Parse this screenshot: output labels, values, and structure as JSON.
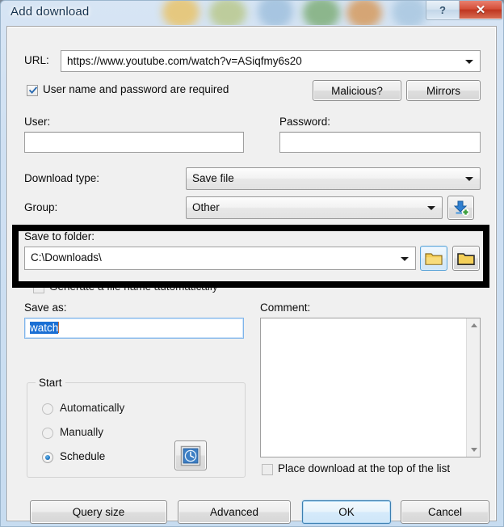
{
  "window": {
    "title": "Add download",
    "help_button": "?",
    "close_button": "✕"
  },
  "form": {
    "url_label": "URL:",
    "url_value": "https://www.youtube.com/watch?v=ASiqfmy6s20",
    "credentials_checkbox_label": "User name and password are required",
    "credentials_checkbox_checked": true,
    "malicious_button": "Malicious?",
    "mirrors_button": "Mirrors",
    "user_label": "User:",
    "user_value": "",
    "password_label": "Password:",
    "password_value": "",
    "download_type_label": "Download type:",
    "download_type_value": "Save file",
    "group_label": "Group:",
    "group_value": "Other",
    "add_group_icon": "download-add-icon",
    "save_to_folder_label": "Save to folder:",
    "save_to_folder_value": "C:\\Downloads\\",
    "browse_folder_icon": "folder-closed-icon",
    "open_folder_icon": "folder-open-icon",
    "generate_name_label": "Generate a file name automatically",
    "generate_name_checked": false,
    "save_as_label": "Save as:",
    "save_as_value": "watch",
    "save_as_selected": true,
    "comment_label": "Comment:",
    "comment_value": "",
    "place_top_label": "Place download at the top of the list",
    "place_top_checked": false
  },
  "start_group": {
    "title": "Start",
    "options": [
      {
        "label": "Automatically",
        "selected": false
      },
      {
        "label": "Manually",
        "selected": false
      },
      {
        "label": "Schedule",
        "selected": true
      }
    ],
    "schedule_button_icon": "clock-schedule-icon"
  },
  "footer": {
    "query_size": "Query size",
    "advanced": "Advanced",
    "ok": "OK",
    "cancel": "Cancel"
  },
  "annotation": {
    "highlight_color": "#000000",
    "highlight_target": "save-to-folder-section"
  },
  "scrollbar": {
    "up_arrow": "scroll-up-arrow",
    "down_arrow": "scroll-down-arrow"
  }
}
